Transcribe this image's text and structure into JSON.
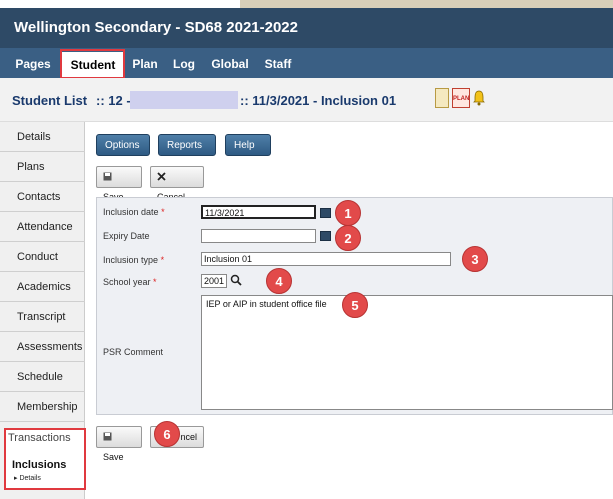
{
  "header": {
    "title": "Wellington Secondary - SD68 2021-2022"
  },
  "tabs": [
    {
      "label": "Pages"
    },
    {
      "label": "Student"
    },
    {
      "label": "Plan"
    },
    {
      "label": "Log"
    },
    {
      "label": "Global"
    },
    {
      "label": "Staff"
    }
  ],
  "breadcrumb": {
    "list_label": "Student List",
    "separator1": ":: 12 -",
    "separator2": ":: 11/3/2021 - Inclusion 01",
    "plan_icon_text": "PLAN"
  },
  "sidebar": {
    "items": [
      "Details",
      "Plans",
      "Contacts",
      "Attendance",
      "Conduct",
      "Academics",
      "Transcript",
      "Assessments",
      "Schedule",
      "Membership"
    ],
    "transactions": "Transactions",
    "inclusions": "Inclusions",
    "details_sub": "▸ Details"
  },
  "toolbar": {
    "options": "Options ▾",
    "reports": "Reports ▾",
    "help": "Help ▾",
    "save": "Save",
    "cancel": "Cancel",
    "cancel_partial": "ncel"
  },
  "form": {
    "inclusion_date_label": "Inclusion date",
    "inclusion_date_value": "11/3/2021",
    "expiry_date_label": "Expiry Date",
    "expiry_date_value": "",
    "inclusion_type_label": "Inclusion type",
    "inclusion_type_value": "Inclusion 01",
    "school_year_label": "School year",
    "school_year_value": "2001",
    "psr_comment_label": "PSR Comment",
    "psr_comment_value": "IEP or AIP in student office file",
    "required_marker": "*"
  },
  "callouts": [
    "1",
    "2",
    "3",
    "4",
    "5",
    "6"
  ],
  "colors": {
    "header": "#2e4a66",
    "tabbar": "#3a5f84",
    "highlight": "#e0393f",
    "badge": "#e24a4a"
  },
  "icons": [
    "calendar-icon",
    "search-icon",
    "save-icon",
    "cancel-icon",
    "bell-icon",
    "plan-icon",
    "document-icon"
  ]
}
